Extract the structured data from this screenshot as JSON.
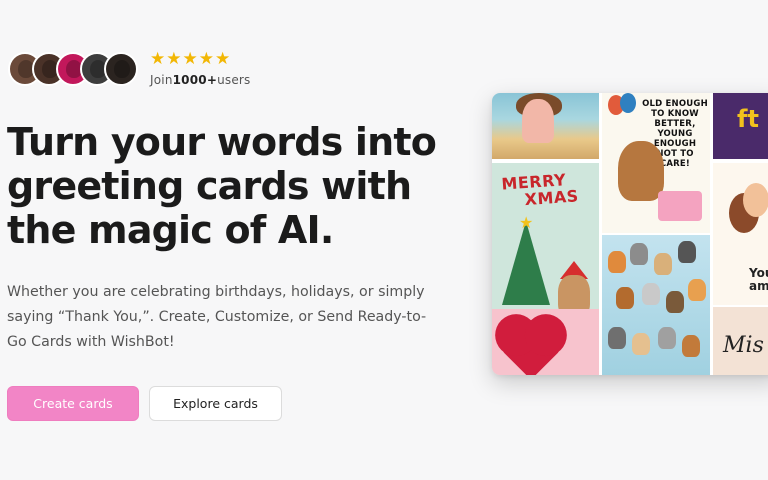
{
  "social_proof": {
    "avatars": [
      "user-avatar-1",
      "user-avatar-2",
      "user-avatar-3",
      "user-avatar-4",
      "user-avatar-5"
    ],
    "star_count": 5,
    "star_glyph": "★",
    "users_prefix": "Join",
    "users_count": "1000+",
    "users_suffix": "users"
  },
  "hero": {
    "headline": "Turn your words into greeting cards with the magic of AI.",
    "subtext": "Whether you are celebrating birthdays, holidays, or simply saying “Thank You,”. Create, Customize, or Send Ready-to-Go Cards with WishBot!"
  },
  "actions": {
    "primary_label": "Create cards",
    "secondary_label": "Explore cards"
  },
  "collage": {
    "birthday_card_text": "OLD ENOUGH TO KNOW BETTER, YOUNG ENOUGH NOT TO CARE!",
    "xmas_line1": "MERRY",
    "xmas_line2": "XMAS",
    "couple_card_text": "You'r amazin",
    "script_card_text": "Mis",
    "fest_card_text": "ft"
  },
  "colors": {
    "primary": "#f285c6",
    "star": "#f2b705",
    "background": "#f7f7f8"
  }
}
